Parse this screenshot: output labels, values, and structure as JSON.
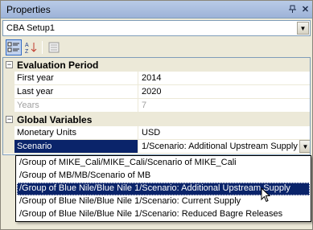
{
  "window": {
    "title": "Properties"
  },
  "object_selector": {
    "value": "CBA Setup1"
  },
  "categories": [
    {
      "label": "Evaluation Period",
      "rows": [
        {
          "name": "First year",
          "value": "2014"
        },
        {
          "name": "Last year",
          "value": "2020"
        },
        {
          "name": "Years",
          "value": "7"
        }
      ]
    },
    {
      "label": "Global Variables",
      "rows": [
        {
          "name": "Monetary Units",
          "value": "USD"
        },
        {
          "name": "Scenario",
          "value": "1/Scenario: Additional Upstream Supply"
        }
      ]
    }
  ],
  "dropdown": {
    "options": [
      "/Group of MIKE_Cali/MIKE_Cali/Scenario of MIKE_Cali",
      "/Group of MB/MB/Scenario of MB",
      "/Group of Blue Nile/Blue Nile 1/Scenario: Additional Upstream Supply",
      "/Group of Blue Nile/Blue Nile 1/Scenario: Current Supply",
      "/Group of Blue Nile/Blue Nile 1/Scenario: Reduced Bagre Releases"
    ],
    "selected_index": 2
  },
  "icons": {
    "pin": "pin-icon",
    "close": "close-icon",
    "categorized": "categorized-icon",
    "alphabetical": "sort-alphabetical-icon",
    "property_pages": "property-pages-icon",
    "expander": "collapse-icon"
  },
  "colors": {
    "selection": "#0a246a",
    "panel": "#ece9d8",
    "titlebar": "#9db3d8"
  }
}
